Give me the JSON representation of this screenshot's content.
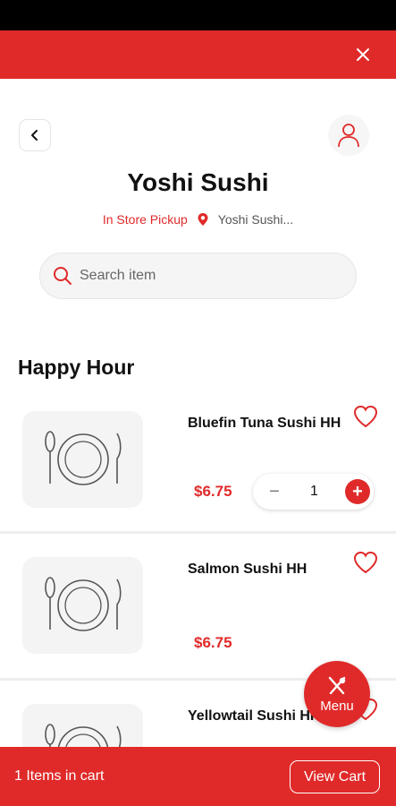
{
  "header": {
    "store_name": "Yoshi Sushi",
    "pickup_mode": "In Store Pickup",
    "location": "Yoshi Sushi..."
  },
  "search": {
    "placeholder": "Search item"
  },
  "section": {
    "title": "Happy Hour"
  },
  "items": [
    {
      "name": "Bluefin Tuna Sushi HH",
      "price": "$6.75",
      "quantity": "1",
      "favorited": false
    },
    {
      "name": "Salmon Sushi HH",
      "price": "$6.75",
      "favorited": false
    },
    {
      "name": "Yellowtail Sushi HH",
      "price": "",
      "favorited": false
    }
  ],
  "fab": {
    "label": "Menu"
  },
  "cart": {
    "count_text": "1 Items in cart",
    "button_label": "View Cart"
  },
  "colors": {
    "accent": "#e02a2a",
    "status_bar": "#000000"
  },
  "icons": {
    "close": "close-icon",
    "back": "chevron-left-icon",
    "profile": "user-icon",
    "location": "location-pin-icon",
    "search": "search-icon",
    "favorite": "heart-icon",
    "placeholder": "plate-utensils-icon",
    "menu": "utensils-icon"
  }
}
